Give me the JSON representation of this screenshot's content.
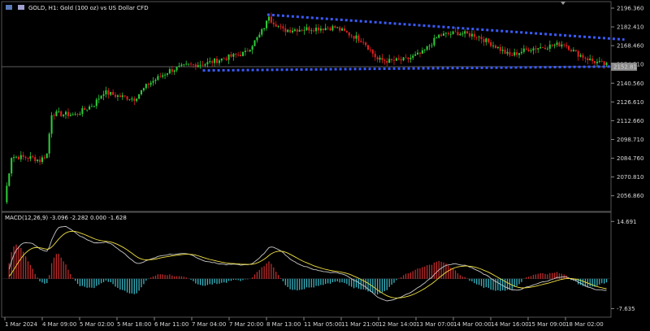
{
  "header": {
    "title": "GOLD, H1:  Gold (100 oz) vs US Dollar CFD",
    "macd_label": "MACD(12,26,9) -3.096 -2.282 0.000 -1.628"
  },
  "colors": {
    "background": "#000000",
    "bull": "#2ecc3a",
    "bear": "#e02020",
    "trendline": "#3a5bff",
    "macd_line": "#c8c8c8",
    "signal_line": "#f0e040",
    "hist_pos": "#c02a2a",
    "hist_neg": "#37b6c4",
    "grid": "#3a3a3a",
    "bid_line": "#7a7a7a"
  },
  "chart_data": [
    {
      "type": "candlestick",
      "symbol": "GOLD",
      "timeframe": "H1",
      "y_ticks": [
        "2196.360",
        "2182.410",
        "2168.460",
        "2154.510",
        "2140.560",
        "2126.610",
        "2112.660",
        "2098.710",
        "2084.760",
        "2070.810",
        "2056.860"
      ],
      "ylim": [
        2047.6,
        2196.36
      ],
      "current_price": "2152.81",
      "x_ticks": [
        "1 Mar 2024",
        "4 Mar 09:00",
        "5 Mar 02:00",
        "5 Mar 18:00",
        "6 Mar 11:00",
        "7 Mar 04:00",
        "7 Mar 20:00",
        "8 Mar 13:00",
        "11 Mar 05:00",
        "11 Mar 21:00",
        "12 Mar 14:00",
        "13 Mar 07:00",
        "14 Mar 00:00",
        "14 Mar 16:00",
        "15 Mar 09:00",
        "18 Mar 02:00"
      ],
      "trendlines": [
        {
          "name": "upper",
          "from": [
            0,
            2191.5
          ],
          "to": [
            1,
            2173.0
          ]
        },
        {
          "name": "lower",
          "from": [
            0,
            2150.0
          ],
          "to": [
            1,
            2153.0
          ]
        }
      ],
      "anchors": [
        [
          0,
          2053
        ],
        [
          3,
          2086
        ],
        [
          12,
          2085
        ],
        [
          15,
          2083
        ],
        [
          18,
          2088
        ],
        [
          20,
          2118
        ],
        [
          30,
          2117
        ],
        [
          38,
          2125
        ],
        [
          42,
          2134
        ],
        [
          48,
          2131
        ],
        [
          55,
          2129
        ],
        [
          61,
          2140
        ],
        [
          70,
          2150
        ],
        [
          78,
          2154
        ],
        [
          85,
          2155
        ],
        [
          95,
          2160
        ],
        [
          102,
          2163
        ],
        [
          108,
          2176
        ],
        [
          112,
          2189
        ],
        [
          118,
          2180
        ],
        [
          128,
          2181
        ],
        [
          140,
          2182
        ],
        [
          152,
          2172
        ],
        [
          158,
          2158
        ],
        [
          163,
          2157
        ],
        [
          170,
          2158
        ],
        [
          177,
          2163
        ],
        [
          184,
          2176
        ],
        [
          192,
          2178
        ],
        [
          200,
          2176
        ],
        [
          208,
          2168
        ],
        [
          214,
          2161
        ],
        [
          222,
          2166
        ],
        [
          230,
          2168
        ],
        [
          237,
          2170
        ],
        [
          242,
          2163
        ],
        [
          249,
          2157
        ],
        [
          255,
          2154
        ]
      ]
    },
    {
      "type": "macd",
      "name": "MACD(12,26,9)",
      "y_ticks": [
        "14.691",
        "-7.635"
      ],
      "ylim": [
        -9.0,
        16.0
      ],
      "values": {
        "macd": -3.096,
        "signal": -2.282,
        "histogram": -1.628
      }
    }
  ]
}
